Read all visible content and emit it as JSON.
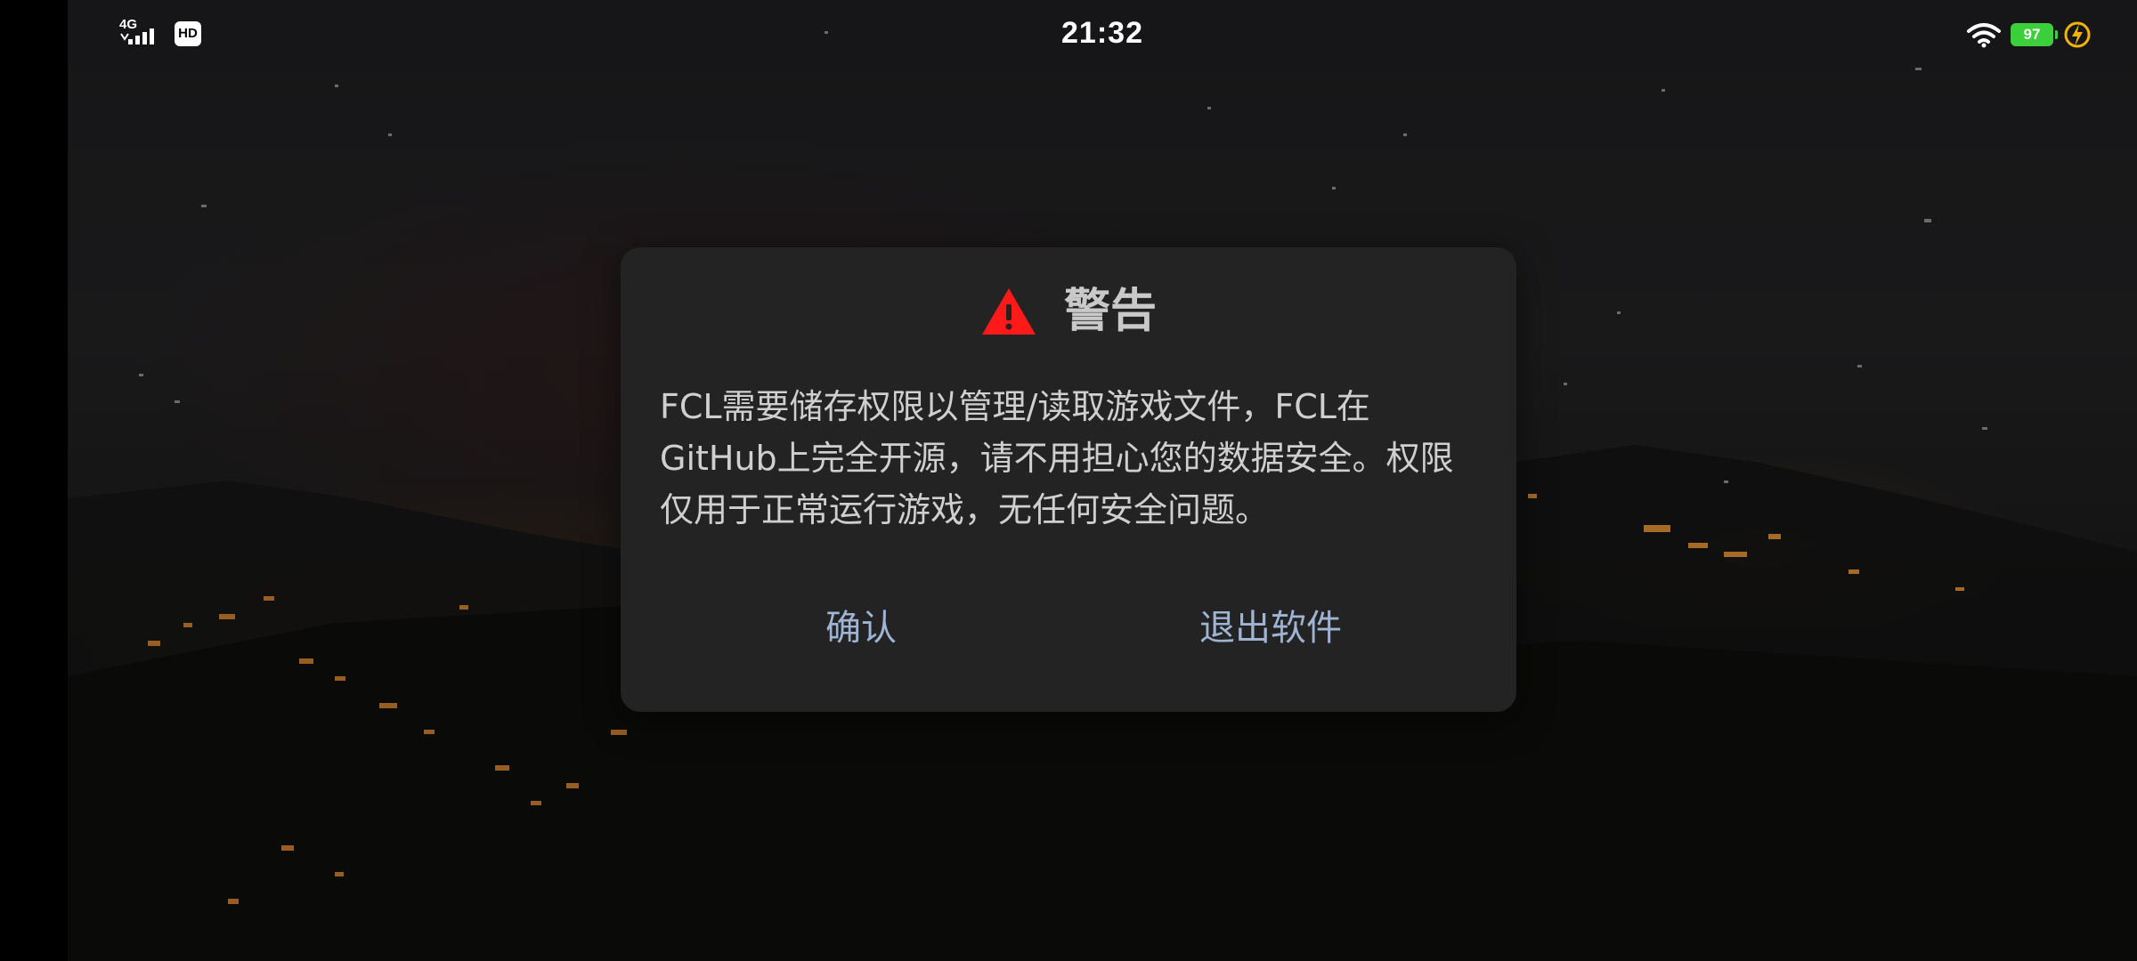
{
  "status_bar": {
    "time": "21:32",
    "network_type": "4G",
    "hd_label": "HD",
    "battery_level": "97",
    "icons": [
      "signal-icon",
      "hd-icon",
      "wifi-icon",
      "battery-icon",
      "charging-bolt-icon"
    ]
  },
  "dialog": {
    "icon": "warning-triangle-icon",
    "title": "警告",
    "message": "FCL需要储存权限以管理/读取游戏文件，FCL在GitHub上完全开源，请不用担心您的数据安全。权限仅用于正常运行游戏，无任何安全问题。",
    "confirm_label": "确认",
    "exit_label": "退出软件"
  },
  "colors": {
    "dialog_bg": "#232323",
    "button_text": "#9fb4d4",
    "warning_icon": "#ff1a1a",
    "battery": "#3ccf3c"
  }
}
